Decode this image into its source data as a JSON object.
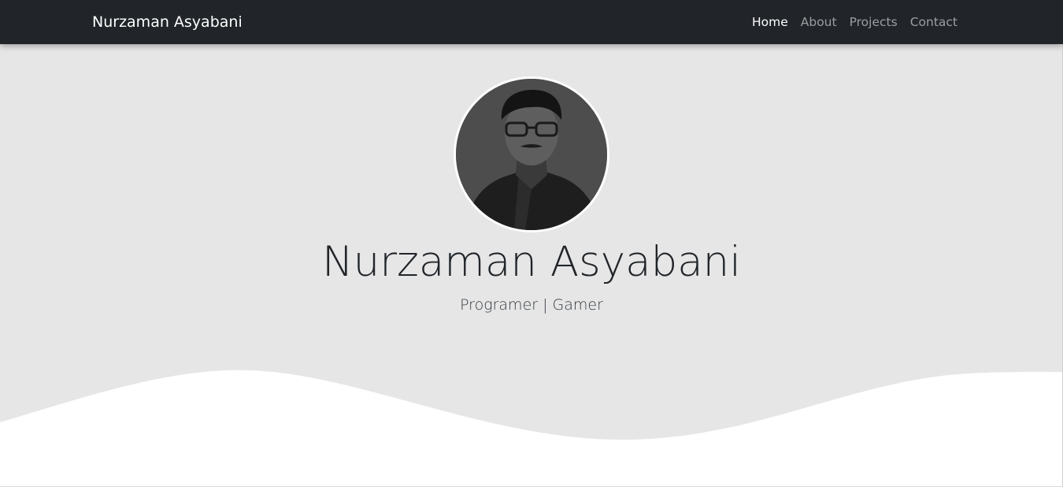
{
  "navbar": {
    "brand": "Nurzaman Asyabani",
    "links": [
      {
        "label": "Home",
        "active": true
      },
      {
        "label": "About",
        "active": false
      },
      {
        "label": "Projects",
        "active": false
      },
      {
        "label": "Contact",
        "active": false
      }
    ]
  },
  "hero": {
    "avatar_icon": "profile-photo",
    "title": "Nurzaman Asyabani",
    "subtitle": "Programer | Gamer"
  },
  "colors": {
    "navbar_bg": "#212529",
    "hero_bg": "#e6e6e6",
    "wave_fill": "#ffffff"
  }
}
